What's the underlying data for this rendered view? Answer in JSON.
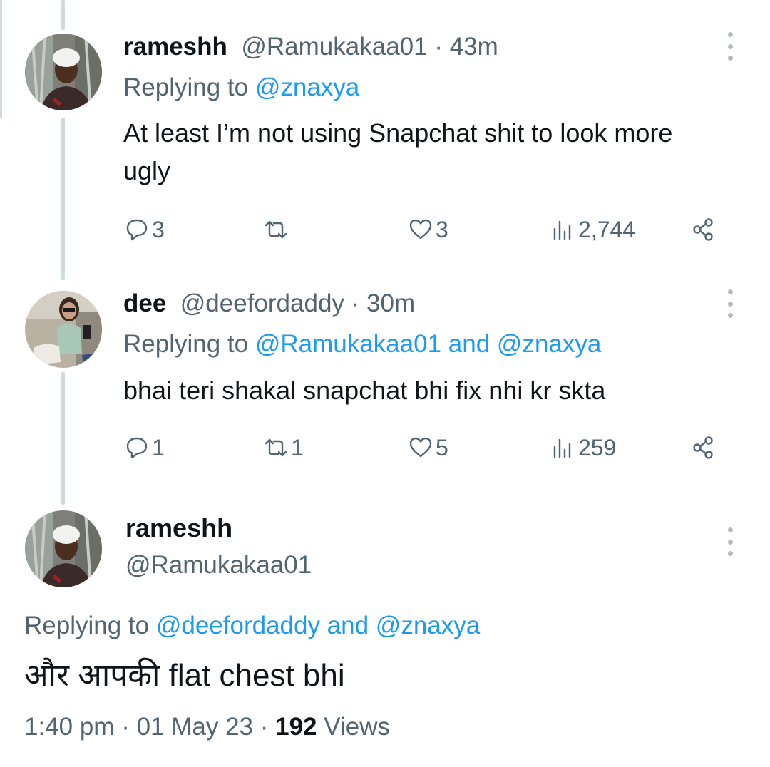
{
  "thread": [
    {
      "name": "rameshh",
      "handle": "@Ramukakaa01",
      "sep": " · ",
      "time": "43m",
      "replying_prefix": "Replying to ",
      "replying_to": "@znaxya",
      "text": "At least I’m not using Snapchat shit to look more ugly",
      "stats": {
        "replies": "3",
        "retweets": "",
        "likes": "3",
        "views": "2,744"
      }
    },
    {
      "name": "dee",
      "handle": "@deefordaddy",
      "sep": " · ",
      "time": "30m",
      "replying_prefix": "Replying to ",
      "replying_to": "@Ramukakaa01 and @znaxya",
      "text": "bhai teri shakal snapchat bhi fix nhi kr skta",
      "stats": {
        "replies": "1",
        "retweets": "1",
        "likes": "5",
        "views": "259"
      }
    }
  ],
  "main_tweet": {
    "name": "rameshh",
    "handle": "@Ramukakaa01",
    "replying_prefix": "Replying to ",
    "replying_to": "@deefordaddy and @znaxya",
    "text": "और आपकी flat chest bhi",
    "time": "1:40 pm",
    "sep1": " · ",
    "date": "01 May 23",
    "sep2": " · ",
    "views_count": "192",
    "views_label": " Views"
  },
  "icons": [
    "reply-icon",
    "retweet-icon",
    "like-icon",
    "views-icon",
    "share-icon",
    "more-icon"
  ],
  "colors": {
    "link": "#1d9bf0",
    "muted": "#536471",
    "text": "#0f1419",
    "thread_line": "#cfd9de"
  }
}
